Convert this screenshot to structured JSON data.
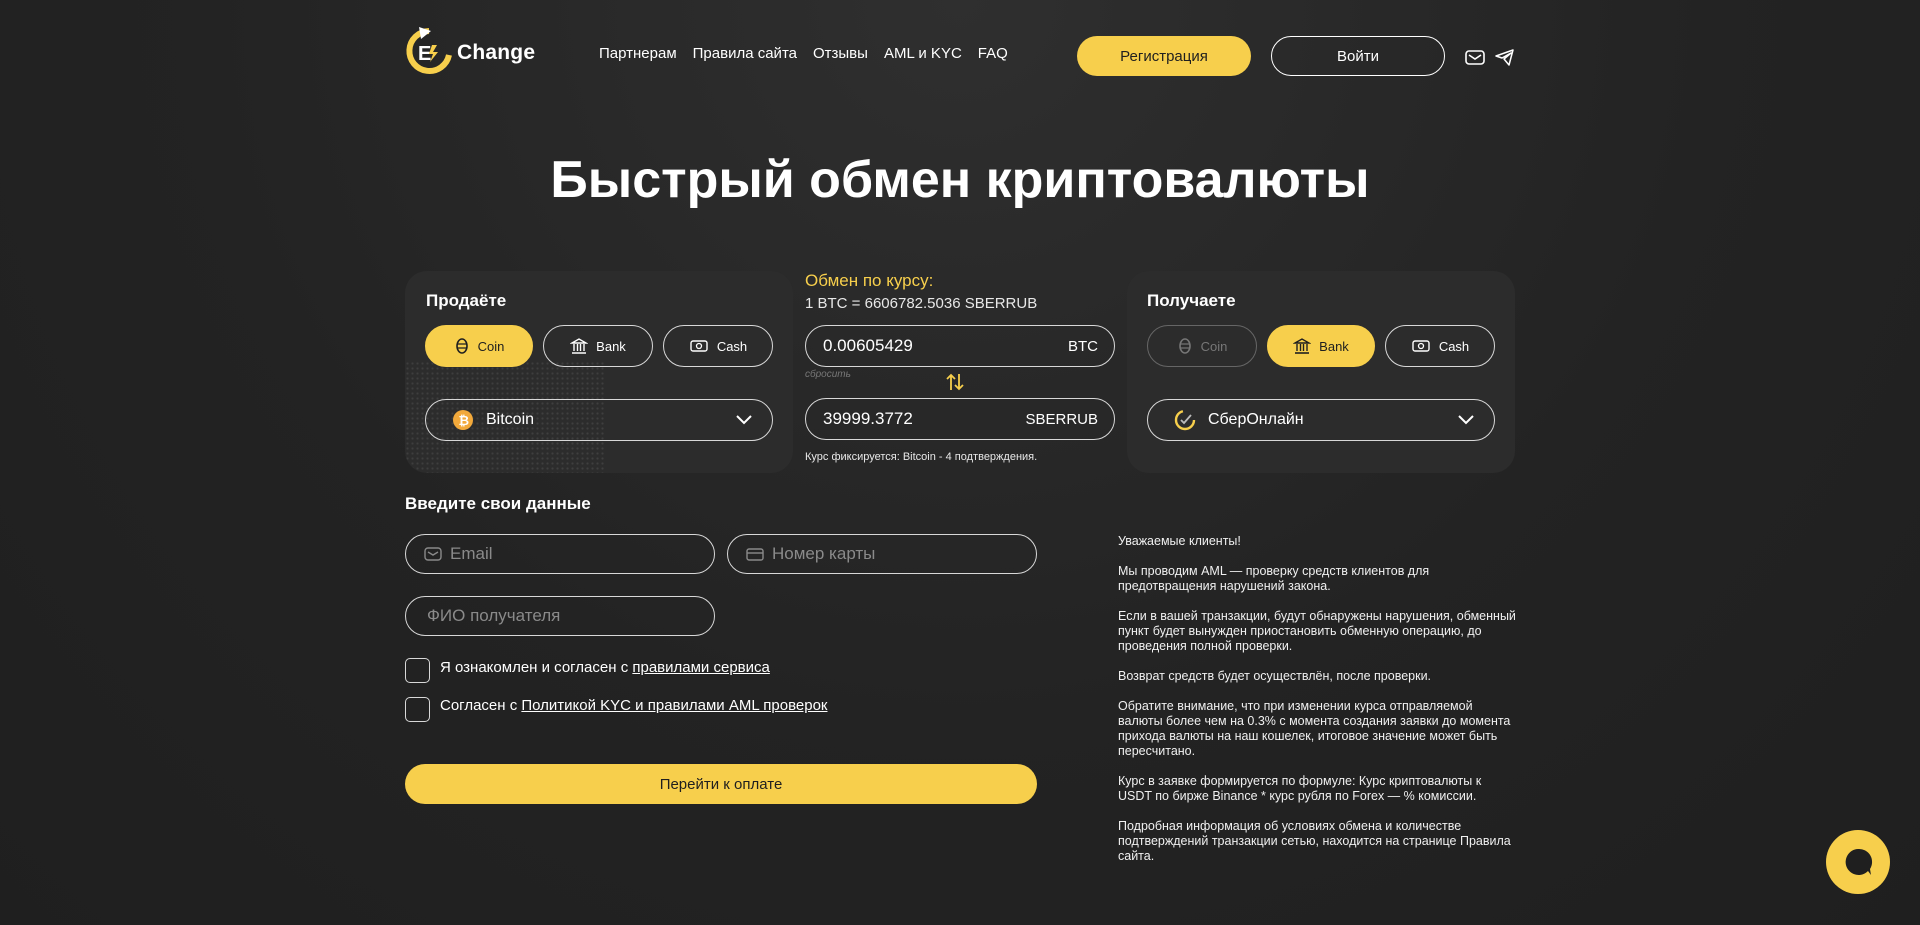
{
  "header": {
    "logo_text": "Change",
    "nav": [
      "Партнерам",
      "Правила сайта",
      "Отзывы",
      "AML и KYC",
      "FAQ"
    ],
    "register_label": "Регистрация",
    "login_label": "Войти"
  },
  "hero": {
    "title": "Быстрый обмен криптовалюты"
  },
  "sell": {
    "title": "Продаёте",
    "types": [
      "Coin",
      "Bank",
      "Cash"
    ],
    "active_type": "Coin",
    "currency": "Bitcoin"
  },
  "rate": {
    "title": "Обмен по курсу:",
    "line": "1 BTC = 6606782.5036 SBERRUB",
    "give_amount": "0.00605429",
    "give_currency": "BTC",
    "reset_label": "сбросить",
    "get_amount": "39999.3772",
    "get_currency": "SBERRUB",
    "note": "Курс фиксируется: Bitcoin - 4 подтверждения."
  },
  "receive": {
    "title": "Получаете",
    "types": [
      "Coin",
      "Bank",
      "Cash"
    ],
    "active_type": "Bank",
    "currency": "СберОнлайн"
  },
  "form": {
    "title": "Введите свои данные",
    "email_placeholder": "Email",
    "card_placeholder": "Номер карты",
    "name_placeholder": "ФИО получателя",
    "agree1_text": "Я ознакомлен и согласен с ",
    "agree1_link": "правилами сервиса",
    "agree2_text": "Согласен с ",
    "agree2_link": "Политикой KYC и правилами AML проверок",
    "submit_label": "Перейти к оплате"
  },
  "info": [
    "Уважаемые клиенты!",
    "Мы проводим AML — проверку средств клиентов для предотвращения нарушений закона.",
    "Если в вашей транзакции, будут обнаружены нарушения, обменный пункт будет вынужден приостановить обменную операцию, до проведения полной проверки.",
    "Возврат средств будет осуществлён, после проверки.",
    "Обратите внимание, что при изменении курса отправляемой валюты более чем на 0.3% с момента создания заявки до момента прихода валюты на наш кошелек, итоговое значение может быть пересчитано.",
    "Курс в заявке формируется по формуле: Курс криптовалюты к USDT по бирже Binance * курс рубля по Forex — % комиссии.",
    "Подробная информация об условиях обмена и количестве подтверждений транзакции сетью, находится на странице Правила сайта."
  ],
  "colors": {
    "accent": "#f7cf4c",
    "background": "#232323",
    "panel": "#2c2c2c"
  }
}
